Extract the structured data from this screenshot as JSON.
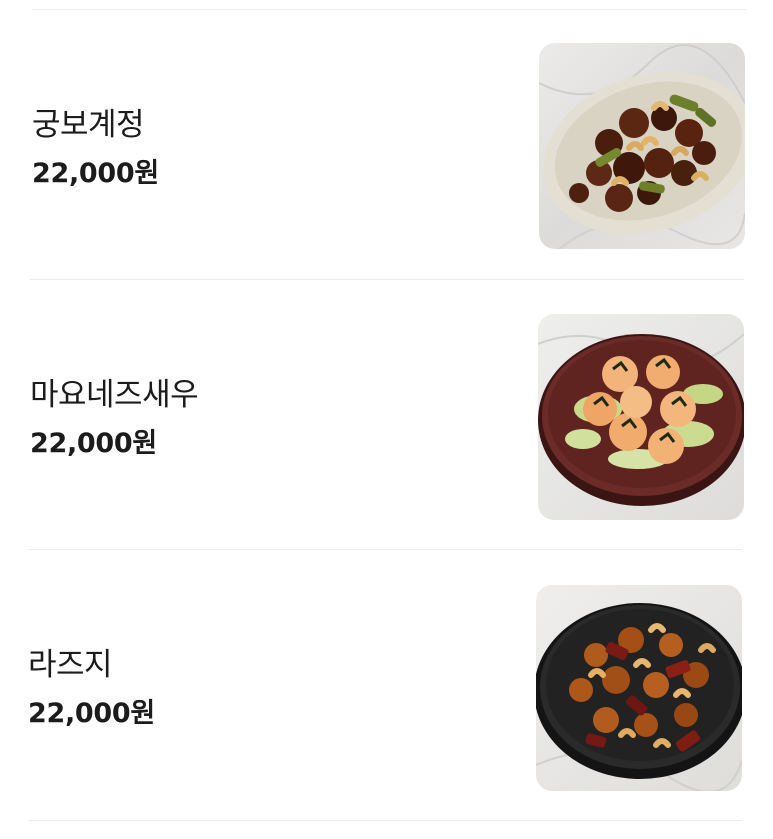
{
  "menu": {
    "items": [
      {
        "name": "궁보계정",
        "price": "22,000원",
        "image_icon": "kung-pao-chicken-photo"
      },
      {
        "name": "마요네즈새우",
        "price": "22,000원",
        "image_icon": "mayonnaise-shrimp-photo"
      },
      {
        "name": "라즈지",
        "price": "22,000원",
        "image_icon": "laziji-spicy-chicken-photo"
      }
    ]
  },
  "colors": {
    "text": "#1c1c1c",
    "divider": "#ececec",
    "background": "#ffffff"
  }
}
